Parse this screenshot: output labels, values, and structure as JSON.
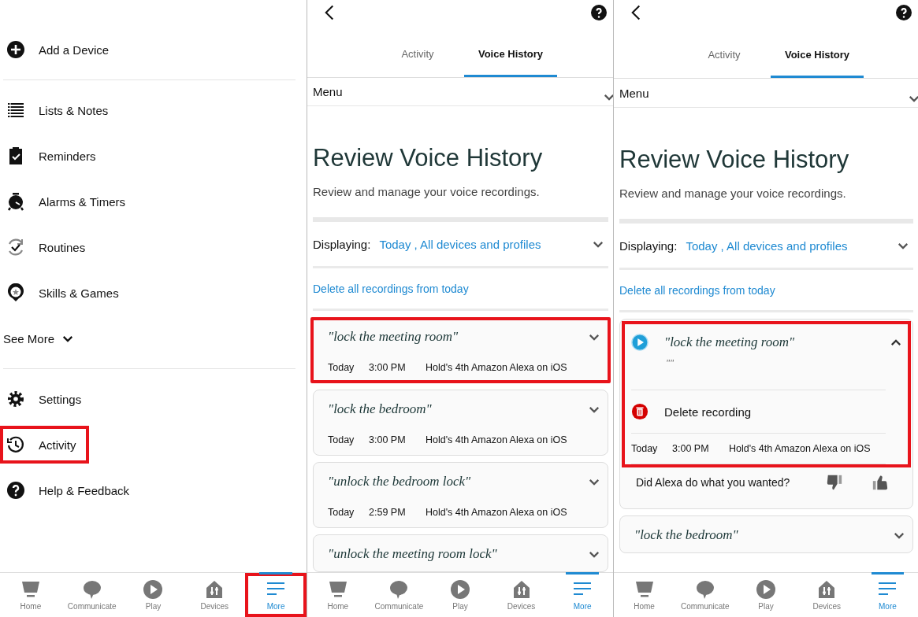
{
  "panels": [
    {
      "kind": "menu",
      "items": [
        {
          "kind": "item",
          "label": "Add a Device",
          "divider_after": true,
          "highlighted": false
        },
        {
          "kind": "item",
          "label": "Lists & Notes",
          "divider_after": false,
          "highlighted": false
        },
        {
          "kind": "item",
          "label": "Reminders",
          "divider_after": false,
          "highlighted": false
        },
        {
          "kind": "item",
          "label": "Alarms & Timers",
          "divider_after": false,
          "highlighted": false
        },
        {
          "kind": "item",
          "label": "Routines",
          "divider_after": false,
          "highlighted": false
        },
        {
          "kind": "item",
          "label": "Skills & Games",
          "divider_after": false,
          "highlighted": false
        },
        {
          "kind": "toggle",
          "label": "See More",
          "divider_after": true,
          "highlighted": false
        },
        {
          "kind": "item",
          "label": "Settings",
          "divider_after": false,
          "highlighted": false
        },
        {
          "kind": "item",
          "label": "Activity",
          "divider_after": false,
          "highlighted": true
        },
        {
          "kind": "item",
          "label": "Help & Feedback",
          "divider_after": false,
          "highlighted": false
        }
      ],
      "nav": [
        {
          "label": "Home",
          "selected": false,
          "highlighted": false
        },
        {
          "label": "Communicate",
          "selected": false,
          "highlighted": false
        },
        {
          "label": "Play",
          "selected": false,
          "highlighted": false
        },
        {
          "label": "Devices",
          "selected": false,
          "highlighted": false
        },
        {
          "label": "More",
          "selected": true,
          "highlighted": true
        }
      ]
    },
    {
      "kind": "voice_history",
      "tabs": [
        {
          "label": "Activity",
          "selected": false
        },
        {
          "label": "Voice History",
          "selected": true
        }
      ],
      "menu_label": "Menu",
      "heading": "Review Voice History",
      "subheading": "Review and manage your voice recordings.",
      "filter_label": "Displaying:",
      "filter_value": "Today , All devices and profiles",
      "delete_all_link": "Delete all recordings from today",
      "recordings": [
        {
          "utterance": "\"lock the meeting room\"",
          "date": "Today",
          "time": "3:00 PM",
          "device": "Hold's 4th Amazon Alexa on iOS",
          "expanded": false,
          "highlighted": true
        },
        {
          "utterance": "\"lock the bedroom\"",
          "date": "Today",
          "time": "3:00 PM",
          "device": "Hold's 4th Amazon Alexa on iOS",
          "expanded": false,
          "highlighted": false
        },
        {
          "utterance": "\"unlock the bedroom lock\"",
          "date": "Today",
          "time": "2:59 PM",
          "device": "Hold's 4th Amazon Alexa on iOS",
          "expanded": false,
          "highlighted": false
        },
        {
          "utterance": "\"unlock the meeting room lock\"",
          "expanded": false,
          "highlighted": false
        }
      ],
      "nav": [
        {
          "label": "Home",
          "selected": false,
          "highlighted": false
        },
        {
          "label": "Communicate",
          "selected": false,
          "highlighted": false
        },
        {
          "label": "Play",
          "selected": false,
          "highlighted": false
        },
        {
          "label": "Devices",
          "selected": false,
          "highlighted": false
        },
        {
          "label": "More",
          "selected": true,
          "highlighted": false
        }
      ]
    },
    {
      "kind": "voice_history",
      "tabs": [
        {
          "label": "Activity",
          "selected": false
        },
        {
          "label": "Voice History",
          "selected": true
        }
      ],
      "menu_label": "Menu",
      "heading": "Review Voice History",
      "subheading": "Review and manage your voice recordings.",
      "filter_label": "Displaying:",
      "filter_value": "Today , All devices and profiles",
      "delete_all_link": "Delete all recordings from today",
      "recordings": [
        {
          "utterance": "\"lock the meeting room\"",
          "response": "\"\"",
          "delete_label": "Delete recording",
          "date": "Today",
          "time": "3:00 PM",
          "device": "Hold's 4th Amazon Alexa on iOS",
          "feedback_question": "Did Alexa do what you wanted?",
          "expanded": true,
          "highlighted": true
        },
        {
          "utterance": "\"lock the bedroom\"",
          "expanded": false,
          "highlighted": false
        }
      ],
      "nav": [
        {
          "label": "Home",
          "selected": false,
          "highlighted": false
        },
        {
          "label": "Communicate",
          "selected": false,
          "highlighted": false
        },
        {
          "label": "Play",
          "selected": false,
          "highlighted": false
        },
        {
          "label": "Devices",
          "selected": false,
          "highlighted": false
        },
        {
          "label": "More",
          "selected": true,
          "highlighted": false
        }
      ]
    }
  ]
}
